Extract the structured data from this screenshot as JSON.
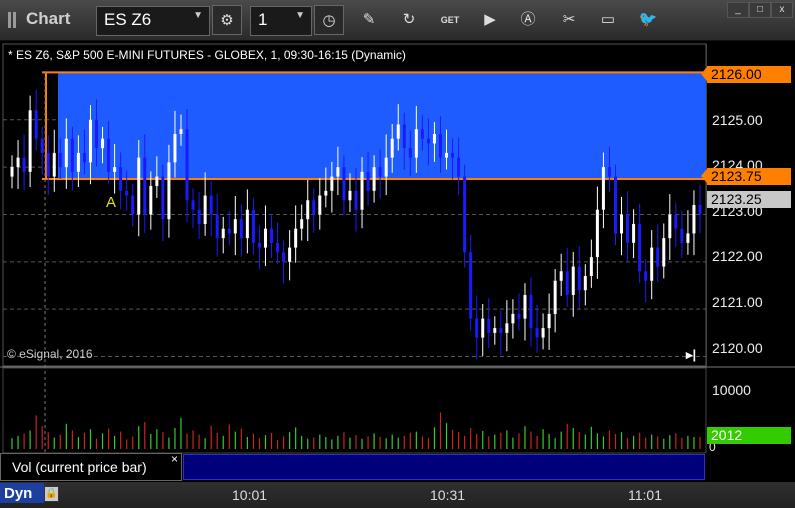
{
  "window": {
    "title": "Chart"
  },
  "toolbar": {
    "symbol_value": "ES Z6",
    "interval_value": "1",
    "icons": [
      "settings-gear-icon",
      "clock-icon",
      "pencil-icon",
      "refresh-icon",
      "get-icon",
      "play-icon",
      "alert-icon",
      "tools-icon",
      "chat-icon",
      "twitter-icon"
    ]
  },
  "window_controls": {
    "minimize": "_",
    "maximize": "□",
    "close": "x"
  },
  "chart": {
    "header": "* ES Z6, S&P 500 E-MINI FUTURES - GLOBEX, 1, 09:30-16:15 (Dynamic)",
    "copyright": "© eSignal, 2016",
    "marker_label": "A"
  },
  "price_axis": {
    "labels": [
      "2125.00",
      "2124.00",
      "2123.00",
      "2122.00",
      "2121.00",
      "2120.00"
    ],
    "tags": {
      "upper": "2126.00",
      "lower": "2123.75",
      "current": "2123.25"
    }
  },
  "volume": {
    "pane_label": "Vol (current price bar)",
    "close": "×",
    "axis_labels": [
      "10000",
      "0"
    ],
    "current_tag": "2012"
  },
  "time_axis": {
    "dyn_label": "Dyn",
    "labels": [
      "10:01",
      "10:31",
      "11:01"
    ]
  },
  "colors": {
    "up": "#ffffff",
    "down": "#1a1aff",
    "band_fill": "#1f5cff",
    "band_line": "#ff8000",
    "vol_up": "#33cc33",
    "vol_down": "#cc2222",
    "vol_tag": "#33cc00"
  },
  "chart_data": {
    "type": "candlestick",
    "interval_minutes": 1,
    "y_range": [
      2119.8,
      2126.6
    ],
    "price_band": {
      "from": 2123.75,
      "to": 2126.0
    },
    "last_price": 2123.25,
    "close_trace": [
      2124.0,
      2124.2,
      2123.9,
      2125.2,
      2124.6,
      2124.3,
      2123.8,
      2124.3,
      2124.0,
      2124.6,
      2123.9,
      2124.3,
      2124.1,
      2125.0,
      2124.4,
      2124.6,
      2123.9,
      2124.0,
      2123.5,
      2123.4,
      2123.0,
      2124.2,
      2123.0,
      2123.6,
      2123.8,
      2122.9,
      2124.1,
      2124.7,
      2124.8,
      2123.3,
      2123.1,
      2122.8,
      2123.4,
      2123.0,
      2122.5,
      2122.7,
      2122.6,
      2122.9,
      2122.5,
      2123.1,
      2122.4,
      2122.3,
      2122.7,
      2122.4,
      2122.2,
      2122.0,
      2122.3,
      2122.7,
      2122.9,
      2123.3,
      2123.0,
      2123.4,
      2123.5,
      2123.8,
      2124.0,
      2123.3,
      2123.5,
      2123.1,
      2123.9,
      2123.5,
      2124.0,
      2123.8,
      2124.2,
      2124.6,
      2124.9,
      2124.4,
      2124.2,
      2124.8,
      2124.6,
      2124.5,
      2124.7,
      2124.2,
      2124.3,
      2124.2,
      2123.8,
      2122.2,
      2120.8,
      2120.4,
      2120.8,
      2120.5,
      2120.6,
      2120.5,
      2120.7,
      2120.9,
      2120.8,
      2121.3,
      2120.6,
      2120.4,
      2120.6,
      2120.9,
      2121.6,
      2121.8,
      2121.3,
      2121.9,
      2121.4,
      2121.7,
      2122.1,
      2123.1,
      2124.0,
      2123.8,
      2122.6,
      2123.0,
      2122.4,
      2122.8,
      2121.8,
      2121.6,
      2122.3,
      2121.9,
      2122.5,
      2123.0,
      2122.7,
      2122.4,
      2122.6,
      2123.2,
      2123.0
    ],
    "volume_trace": [
      1800,
      2200,
      2600,
      3100,
      5600,
      3800,
      2800,
      1900,
      2400,
      4200,
      3100,
      2000,
      2700,
      3300,
      1700,
      2600,
      3400,
      2200,
      2900,
      1600,
      2100,
      3800,
      4500,
      2500,
      3300,
      2800,
      1900,
      3500,
      5200,
      2600,
      3100,
      2400,
      1800,
      3900,
      2700,
      2200,
      4100,
      2900,
      3400,
      2000,
      2600,
      1800,
      2300,
      2700,
      1500,
      2100,
      2800,
      3600,
      2200,
      1700,
      1900,
      2400,
      2000,
      1600,
      2200,
      2800,
      1900,
      2300,
      1700,
      2100,
      2600,
      2000,
      1800,
      2400,
      1900,
      2200,
      2700,
      2900,
      2100,
      1800,
      3600,
      6100,
      4300,
      3200,
      2800,
      2200,
      3500,
      2500,
      3000,
      2100,
      2400,
      2700,
      3100,
      1900,
      2600,
      3800,
      2900,
      2200,
      3300,
      2500,
      1800,
      2900,
      4200,
      3500,
      2800,
      2400,
      3700,
      2600,
      2100,
      3100,
      2500,
      2800,
      1800,
      2200,
      2700,
      1900,
      2400,
      2100,
      1700,
      2300,
      2600,
      1900,
      2200,
      2000,
      2012
    ],
    "annotations": [
      {
        "text": "A",
        "price": 2123.25
      }
    ]
  }
}
